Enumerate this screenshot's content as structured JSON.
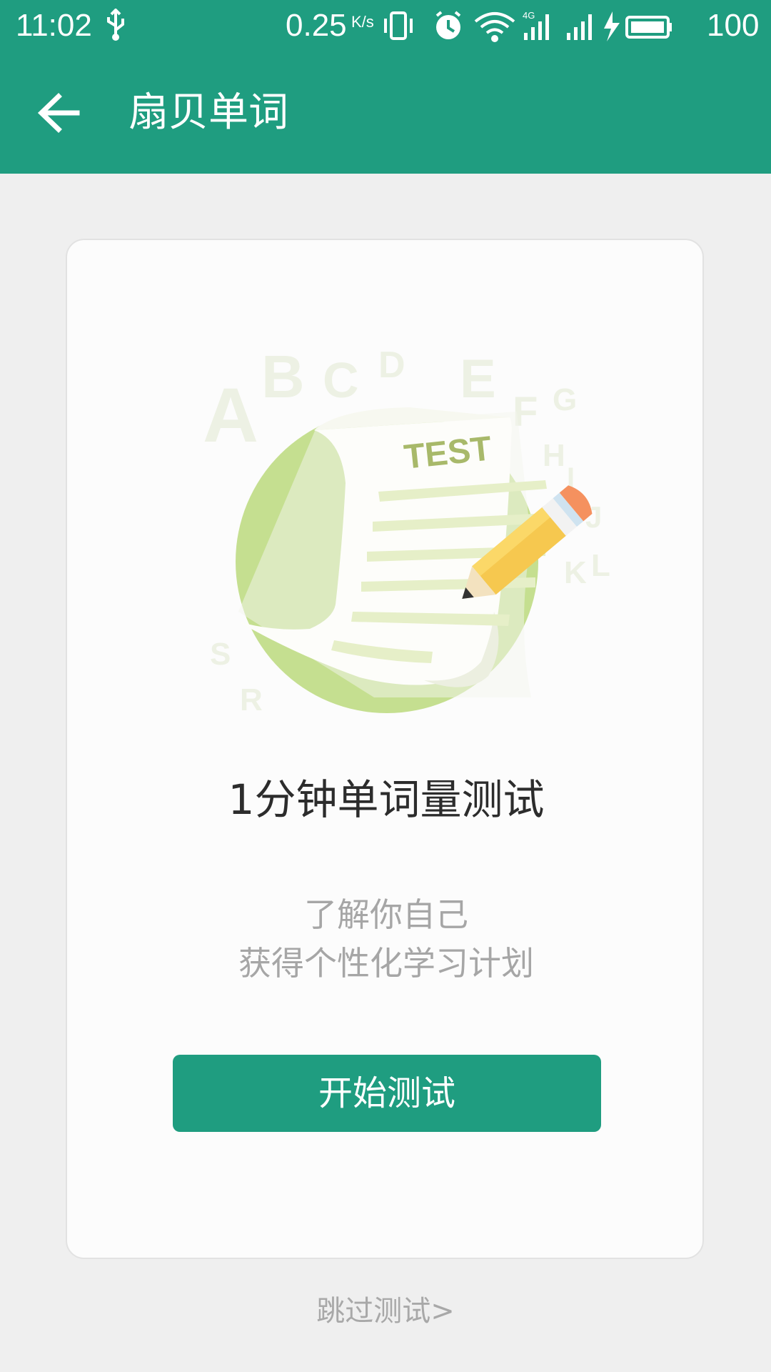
{
  "status_bar": {
    "time": "11:02",
    "speed": "0.25",
    "speed_unit": "K/s",
    "network": "4G",
    "battery": "100",
    "icons": [
      "usb-icon",
      "vibrate-icon",
      "alarm-icon",
      "wifi-icon",
      "signal-4g-icon",
      "signal-icon",
      "charging-icon",
      "battery-icon"
    ]
  },
  "app_bar": {
    "title": "扇贝单词",
    "back_icon": "arrow-left-icon"
  },
  "card": {
    "illustration": {
      "paper_label": "TEST",
      "letters": [
        "A",
        "B",
        "C",
        "D",
        "E",
        "F",
        "G",
        "H",
        "I",
        "J",
        "K",
        "L",
        "S",
        "R"
      ]
    },
    "title": "1分钟单词量测试",
    "description_line1": "了解你自己",
    "description_line2": "获得个性化学习计划",
    "start_button": "开始测试"
  },
  "skip_link": "跳过测试>",
  "colors": {
    "primary": "#1f9d80",
    "background": "#efefef",
    "card": "#fcfcfc",
    "circle": "#c5df90",
    "paper_lines": "#e6efc8",
    "test_text": "#a8b96a"
  }
}
